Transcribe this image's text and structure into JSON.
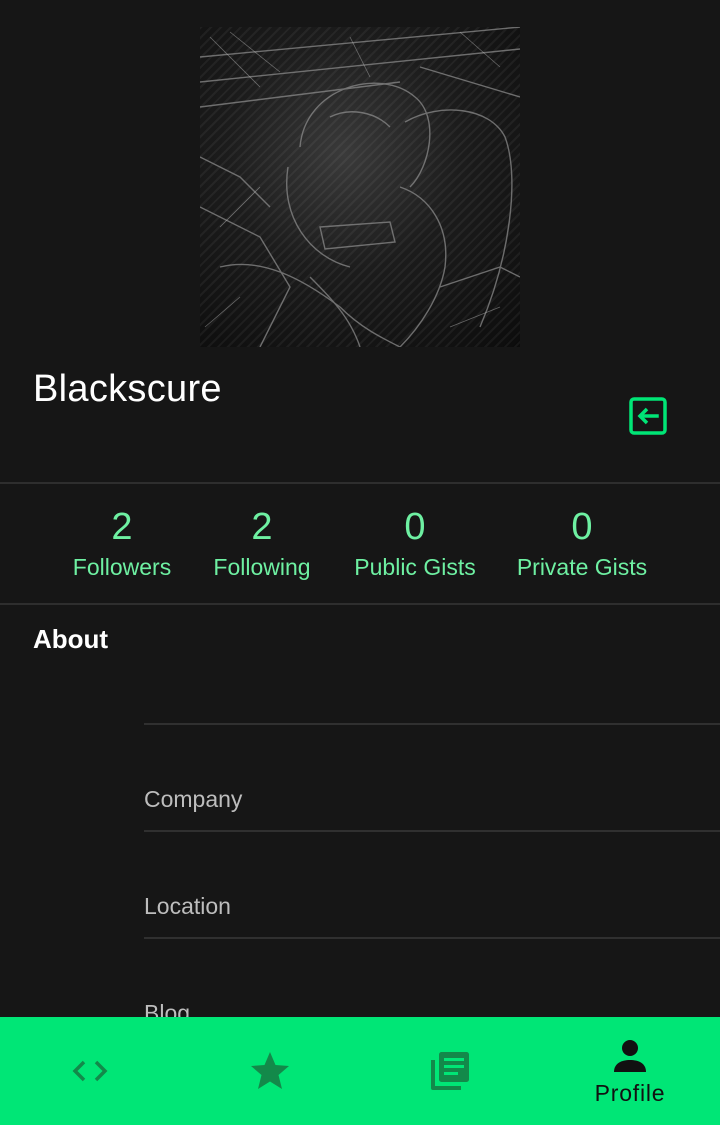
{
  "profile": {
    "username": "Blackscure",
    "avatar_alt": "profile-avatar"
  },
  "actions": {
    "logout_icon": "logout-icon"
  },
  "stats": [
    {
      "count": "2",
      "label": "Followers"
    },
    {
      "count": "2",
      "label": "Following"
    },
    {
      "count": "0",
      "label": "Public Gists"
    },
    {
      "count": "0",
      "label": "Private Gists"
    }
  ],
  "about": {
    "heading": "About",
    "fields": [
      {
        "label": ""
      },
      {
        "label": "Company"
      },
      {
        "label": "Location"
      },
      {
        "label": "Blog"
      }
    ]
  },
  "bottom_nav": {
    "items": [
      {
        "icon": "code-icon",
        "label": ""
      },
      {
        "icon": "star-icon",
        "label": ""
      },
      {
        "icon": "library-icon",
        "label": ""
      },
      {
        "icon": "person-icon",
        "label": "Profile",
        "active": true
      }
    ]
  },
  "colors": {
    "background": "#161616",
    "accent": "#00e676",
    "stat_text": "#6ef0a2",
    "nav_icon_inactive": "#13894a",
    "nav_icon_active": "#111111"
  }
}
